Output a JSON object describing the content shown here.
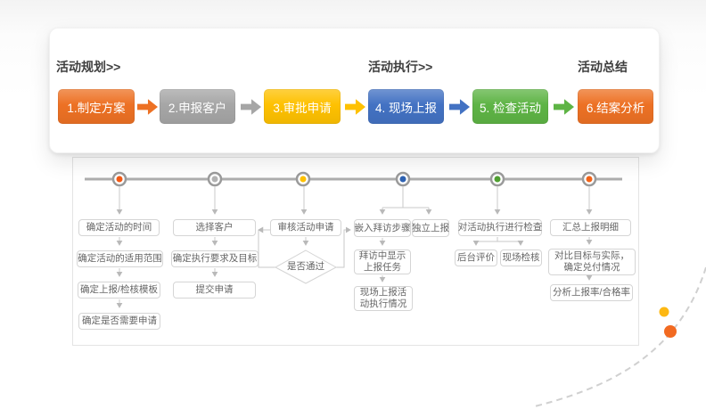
{
  "pipeline": {
    "stage_headers": [
      {
        "label": "活动规划>>"
      },
      {
        "label": "活动执行>>"
      },
      {
        "label": "活动总结"
      }
    ],
    "steps": [
      {
        "label": "1.制定方案",
        "color": "#ED7124"
      },
      {
        "label": "2.申报客户",
        "color": "#A6A6A6"
      },
      {
        "label": "3.审批申请",
        "color": "#FEC101"
      },
      {
        "label": "4. 现场上报",
        "color": "#4372C3"
      },
      {
        "label": "5. 检查活动",
        "color": "#5EB445"
      },
      {
        "label": "6.结案分析",
        "color": "#ED7124"
      }
    ]
  },
  "flow": {
    "columns": [
      {
        "dot_color": "#F25B16",
        "items": [
          "确定活动的时间",
          "确定活动的适用范围",
          "确定上报/检核模板",
          "确定是否需要申请"
        ]
      },
      {
        "dot_color": "#B3B3B3",
        "items": [
          "选择客户",
          "确定执行要求及目标",
          "提交申请"
        ]
      },
      {
        "dot_color": "#FEC101",
        "items": [
          "审核活动申请"
        ],
        "diamond": "是否通过"
      },
      {
        "dot_color": "#2E62B2",
        "items": [
          "嵌入拜访步骤",
          "独立上报",
          "拜访中显示上报任务",
          "现场上报活动执行情况"
        ]
      },
      {
        "dot_color": "#51A033",
        "items": [
          "对活动执行进行检查",
          "后台评价",
          "现场检核"
        ]
      },
      {
        "dot_color": "#F26419",
        "items": [
          "汇总上报明细",
          "对比目标与实际，确定兑付情况",
          "分析上报率/合格率"
        ]
      }
    ]
  },
  "decor": {
    "small_dot_color": "#FDB813",
    "large_dot_color": "#F26A21"
  }
}
